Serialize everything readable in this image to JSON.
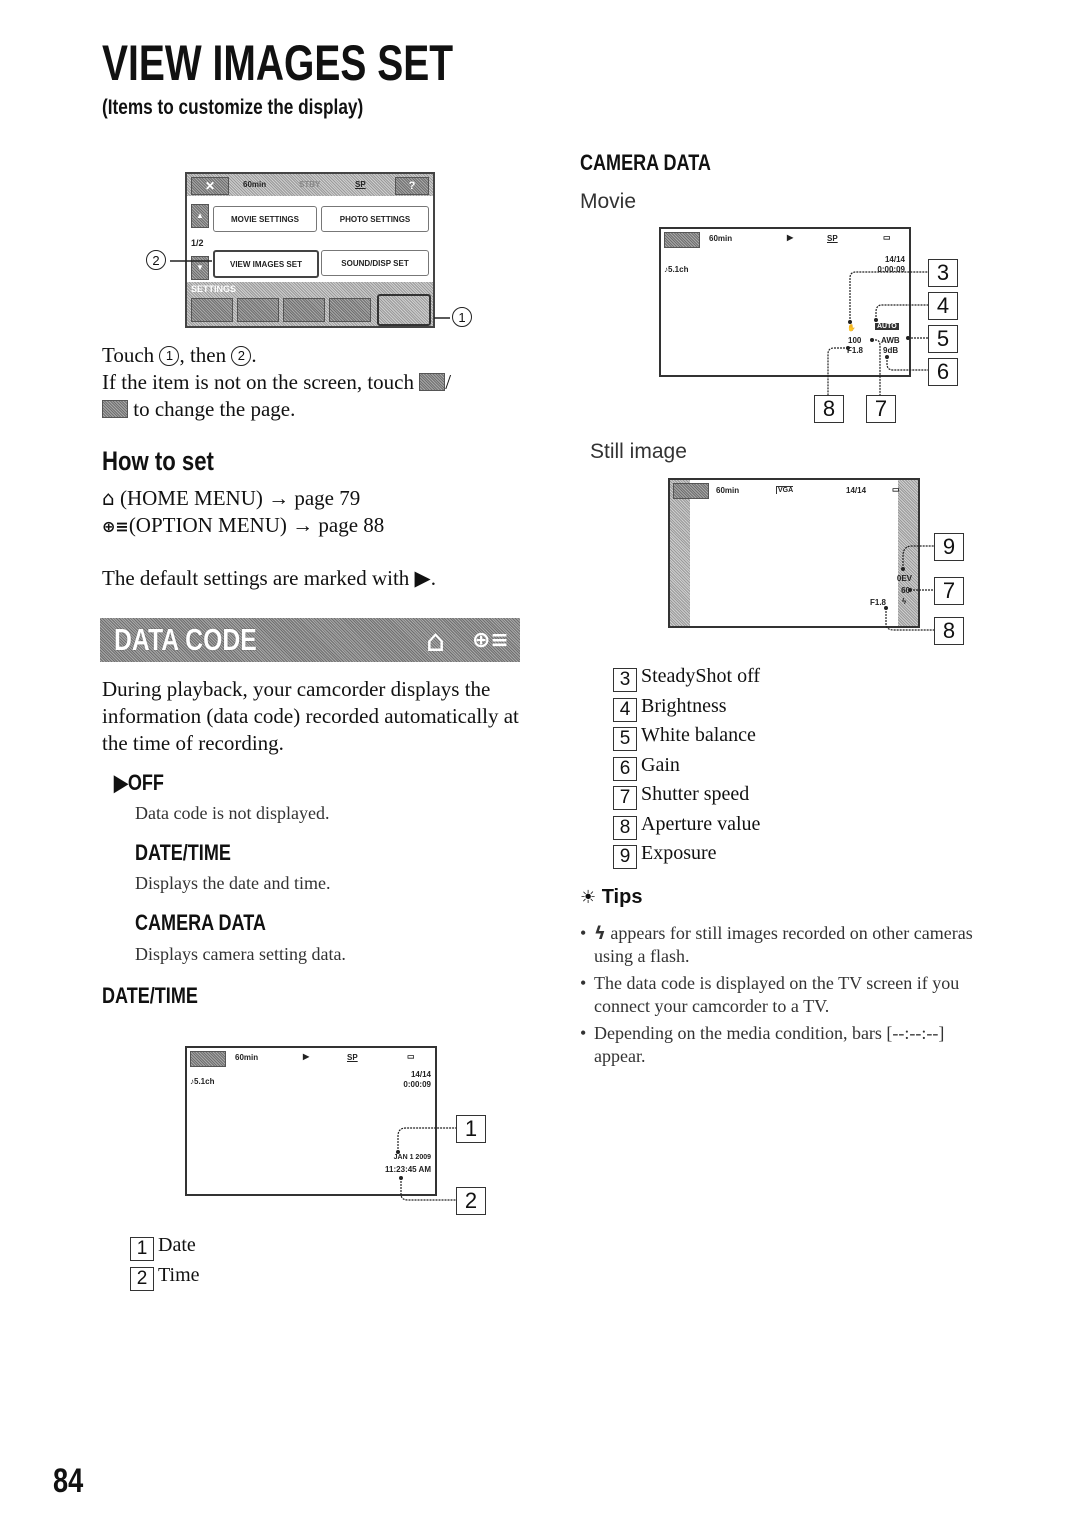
{
  "page": {
    "title": "VIEW IMAGES SET",
    "subtitle": "(Items to customize the display)",
    "page_number": "84"
  },
  "menu_screen": {
    "remaining": "60min",
    "standby": "STBY",
    "quality": "SP",
    "help": "?",
    "page_indicator": "1/2",
    "buttons": [
      "MOVIE SETTINGS",
      "PHOTO SETTINGS",
      "VIEW IMAGES SET",
      "SOUND/DISP SET"
    ],
    "category_label": "SETTINGS",
    "callout_1": "1",
    "callout_2": "2"
  },
  "instructions": {
    "line1_prefix": "Touch",
    "line1_mid": ", then",
    "line1_end": ".",
    "circle1": "1",
    "circle2": "2",
    "line2": "If the item is not on the screen, touch",
    "line2_end": "/",
    "line3": "to change the page."
  },
  "how_to_set": {
    "heading": "How to set",
    "home_menu": "(HOME MENU) → page 79",
    "option_menu": "(OPTION MENU) → page 88",
    "default_note": "The default settings are marked with ▶."
  },
  "data_code": {
    "banner": "DATA CODE",
    "description": "During playback, your camcorder displays the information (data code) recorded automatically at the time of recording.",
    "options": [
      {
        "label": "▶OFF",
        "desc": "Data code is not displayed."
      },
      {
        "label": "DATE/TIME",
        "desc": "Displays the date and time."
      },
      {
        "label": "CAMERA DATA",
        "desc": "Displays camera setting data."
      }
    ]
  },
  "datetime_section": {
    "heading": "DATE/TIME",
    "screen": {
      "remaining": "60min",
      "quality": "SP",
      "audio": "♪5.1ch",
      "counter": "14/14",
      "time_code": "0:00:09",
      "date": "JAN  1  2009",
      "time": "11:23:45 AM"
    },
    "legend": [
      {
        "num": "1",
        "label": "Date"
      },
      {
        "num": "2",
        "label": "Time"
      }
    ]
  },
  "camera_data_section": {
    "heading": "CAMERA DATA",
    "movie_label": "Movie",
    "movie_screen": {
      "remaining": "60min",
      "quality": "SP",
      "audio": "♪5.1ch",
      "counter": "14/14",
      "time_code": "0:00:09",
      "brightness": "AUTO",
      "shutter": "100",
      "white_balance": "AWB",
      "aperture": "F1.8",
      "gain": "9dB"
    },
    "movie_callouts": [
      "3",
      "4",
      "5",
      "6",
      "8",
      "7"
    ],
    "still_label": "Still image",
    "still_screen": {
      "remaining": "60min",
      "size": "VGA",
      "counter": "14/14",
      "exposure": "0EV",
      "shutter": "60",
      "aperture": "F1.8"
    },
    "still_callouts": [
      "9",
      "7",
      "8"
    ],
    "legend": [
      {
        "num": "3",
        "label": "SteadyShot off"
      },
      {
        "num": "4",
        "label": "Brightness"
      },
      {
        "num": "5",
        "label": "White balance"
      },
      {
        "num": "6",
        "label": "Gain"
      },
      {
        "num": "7",
        "label": "Shutter speed"
      },
      {
        "num": "8",
        "label": "Aperture value"
      },
      {
        "num": "9",
        "label": "Exposure"
      }
    ]
  },
  "tips": {
    "heading": "Tips",
    "items": [
      "appears for still images recorded on other cameras using a flash.",
      "The data code is displayed on the TV screen if you connect your camcorder to a TV.",
      "Depending on the media condition, bars [--:--:--] appear."
    ]
  }
}
